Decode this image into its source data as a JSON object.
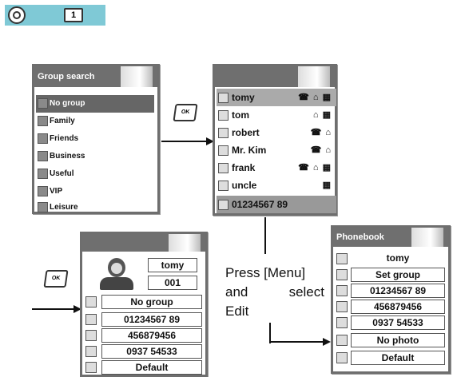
{
  "header": {
    "key_label": "1"
  },
  "group_search": {
    "title": "Group search",
    "items": [
      "No group",
      "Family",
      "Friends",
      "Business",
      "Useful",
      "VIP",
      "Leisure"
    ]
  },
  "contacts_list": {
    "rows": [
      {
        "name": "tomy",
        "tags": "☎ ⌂ ▦"
      },
      {
        "name": "tom",
        "tags": "⌂ ▦"
      },
      {
        "name": "robert",
        "tags": "☎ ⌂"
      },
      {
        "name": "Mr. Kim",
        "tags": "☎ ⌂"
      },
      {
        "name": "frank",
        "tags": "☎ ⌂ ▦"
      },
      {
        "name": "uncle",
        "tags": "▦"
      }
    ],
    "number": "01234567 89"
  },
  "ok_key": "OK",
  "detail_screen": {
    "name": "tomy",
    "position": "001",
    "group": "No group",
    "mobile": "01234567 89",
    "home": "456879456",
    "office": "0937 54533",
    "ring": "Default"
  },
  "edit_screen": {
    "title": "Phonebook",
    "name": "tomy",
    "group": "Set group",
    "mobile": "01234567 89",
    "home": "456879456",
    "office": "0937 54533",
    "photo": "No photo",
    "ring": "Default"
  },
  "instruction": {
    "line1": "Press [Menu]",
    "line2a": "and",
    "line2b": "select",
    "line3": "Edit"
  }
}
